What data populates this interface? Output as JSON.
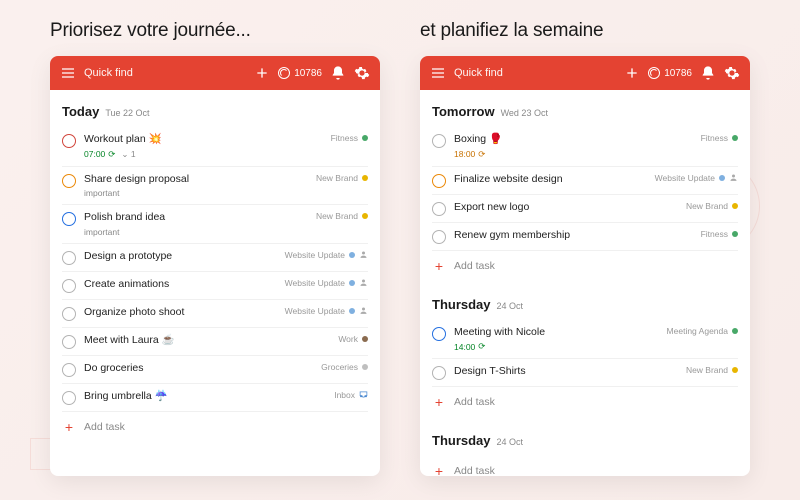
{
  "headlines": {
    "left": "Priorisez votre journée...",
    "right": "et planifiez la semaine"
  },
  "topbar": {
    "search": "Quick find",
    "karma": "10786"
  },
  "addTaskLabel": "Add task",
  "projects": {
    "fitness": {
      "label": "Fitness",
      "color": "#48a868"
    },
    "newBrand": {
      "label": "New Brand",
      "color": "#e8b500"
    },
    "websiteUpdate": {
      "label": "Website Update",
      "color": "#7fb0e0",
      "shared": true
    },
    "work": {
      "label": "Work",
      "color": "#8a6b4f"
    },
    "groceries": {
      "label": "Groceries",
      "color": "#bfbfbf"
    },
    "inbox": {
      "label": "Inbox",
      "icon": "inbox"
    },
    "meetingAgenda": {
      "label": "Meeting Agenda",
      "color": "#48a868"
    }
  },
  "left": {
    "sectionTitle": "Today",
    "sectionDate": "Tue 22 Oct",
    "tasks": [
      {
        "title": "Workout plan 💥",
        "priority": "p1",
        "time": "07:00",
        "recurring": true,
        "subcount": "1",
        "project": "fitness"
      },
      {
        "title": "Share design proposal",
        "priority": "p2",
        "meta": "important",
        "project": "newBrand"
      },
      {
        "title": "Polish brand idea",
        "priority": "p3",
        "meta": "important",
        "project": "newBrand"
      },
      {
        "title": "Design a prototype",
        "priority": "p4",
        "project": "websiteUpdate"
      },
      {
        "title": "Create animations",
        "priority": "p4",
        "project": "websiteUpdate"
      },
      {
        "title": "Organize photo shoot",
        "priority": "p4",
        "project": "websiteUpdate"
      },
      {
        "title": "Meet with Laura ☕",
        "priority": "p4",
        "project": "work"
      },
      {
        "title": "Do groceries",
        "priority": "p4",
        "project": "groceries"
      },
      {
        "title": "Bring umbrella ☔",
        "priority": "p4",
        "project": "inbox"
      }
    ]
  },
  "right": {
    "sections": [
      {
        "title": "Tomorrow",
        "date": "Wed 23 Oct",
        "tasks": [
          {
            "title": "Boxing 🥊",
            "priority": "p4",
            "time": "18:00",
            "timeClass": "evening",
            "recurring": true,
            "project": "fitness"
          },
          {
            "title": "Finalize website design",
            "priority": "p2",
            "project": "websiteUpdate"
          },
          {
            "title": "Export new logo",
            "priority": "p4",
            "project": "newBrand"
          },
          {
            "title": "Renew gym membership",
            "priority": "p4",
            "project": "fitness"
          }
        ]
      },
      {
        "title": "Thursday",
        "date": "24 Oct",
        "tasks": [
          {
            "title": "Meeting with Nicole",
            "priority": "p3",
            "time": "14:00",
            "recurring": true,
            "project": "meetingAgenda"
          },
          {
            "title": "Design T-Shirts",
            "priority": "p4",
            "project": "newBrand"
          }
        ]
      },
      {
        "title": "Thursday",
        "date": "24 Oct",
        "tasks": []
      }
    ]
  }
}
